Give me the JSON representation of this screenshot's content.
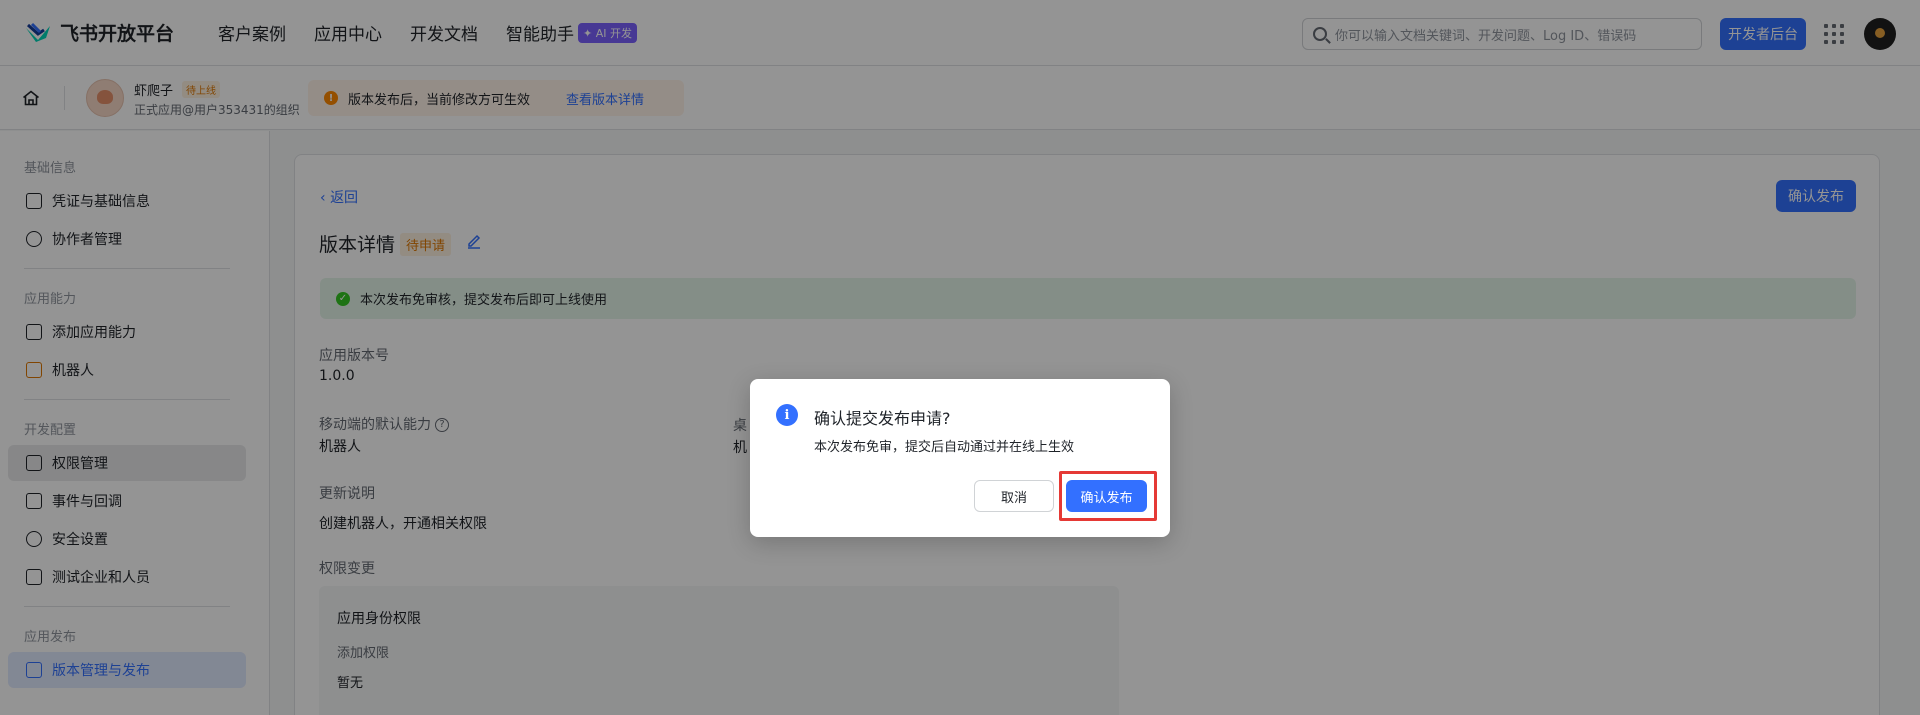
{
  "topnav": {
    "brand": "飞书开放平台",
    "links": [
      "客户案例",
      "应用中心",
      "开发文档",
      "智能助手"
    ],
    "ai_badge": "✦ AI 开发",
    "search_placeholder": "你可以输入文档关键词、开发问题、Log ID、错误码",
    "dev_console": "开发者后台"
  },
  "subhead": {
    "app_name": "虾爬子",
    "app_status": "待上线",
    "app_org": "正式应用@用户353431的组织",
    "notice": "版本发布后，当前修改方可生效",
    "notice_link": "查看版本详情"
  },
  "sidebar": {
    "groups": [
      "基础信息",
      "应用能力",
      "开发配置",
      "应用发布"
    ],
    "items": [
      {
        "label": "凭证与基础信息"
      },
      {
        "label": "协作者管理"
      },
      {
        "label": "添加应用能力"
      },
      {
        "label": "机器人"
      },
      {
        "label": "权限管理"
      },
      {
        "label": "事件与回调"
      },
      {
        "label": "安全设置"
      },
      {
        "label": "测试企业和人员"
      },
      {
        "label": "版本管理与发布"
      }
    ]
  },
  "main": {
    "back": "返回",
    "confirm_publish": "确认发布",
    "title": "版本详情",
    "status_tag": "待申请",
    "success_msg": "本次发布免审核，提交发布后即可上线使用",
    "version_label": "应用版本号",
    "version_value": "1.0.0",
    "mobile_label": "移动端的默认能力",
    "mobile_value": "机器人",
    "desktop_label_partial": "桌",
    "desktop_value_partial": "机",
    "update_label": "更新说明",
    "update_value": "创建机器人，开通相关权限",
    "perm_label": "权限变更",
    "perm_box_title": "应用身份权限",
    "perm_box_sub": "添加权限",
    "perm_box_val": "暂无"
  },
  "modal": {
    "title": "确认提交发布申请?",
    "desc": "本次发布免审，提交后自动通过并在线上生效",
    "cancel": "取消",
    "confirm": "确认发布"
  }
}
